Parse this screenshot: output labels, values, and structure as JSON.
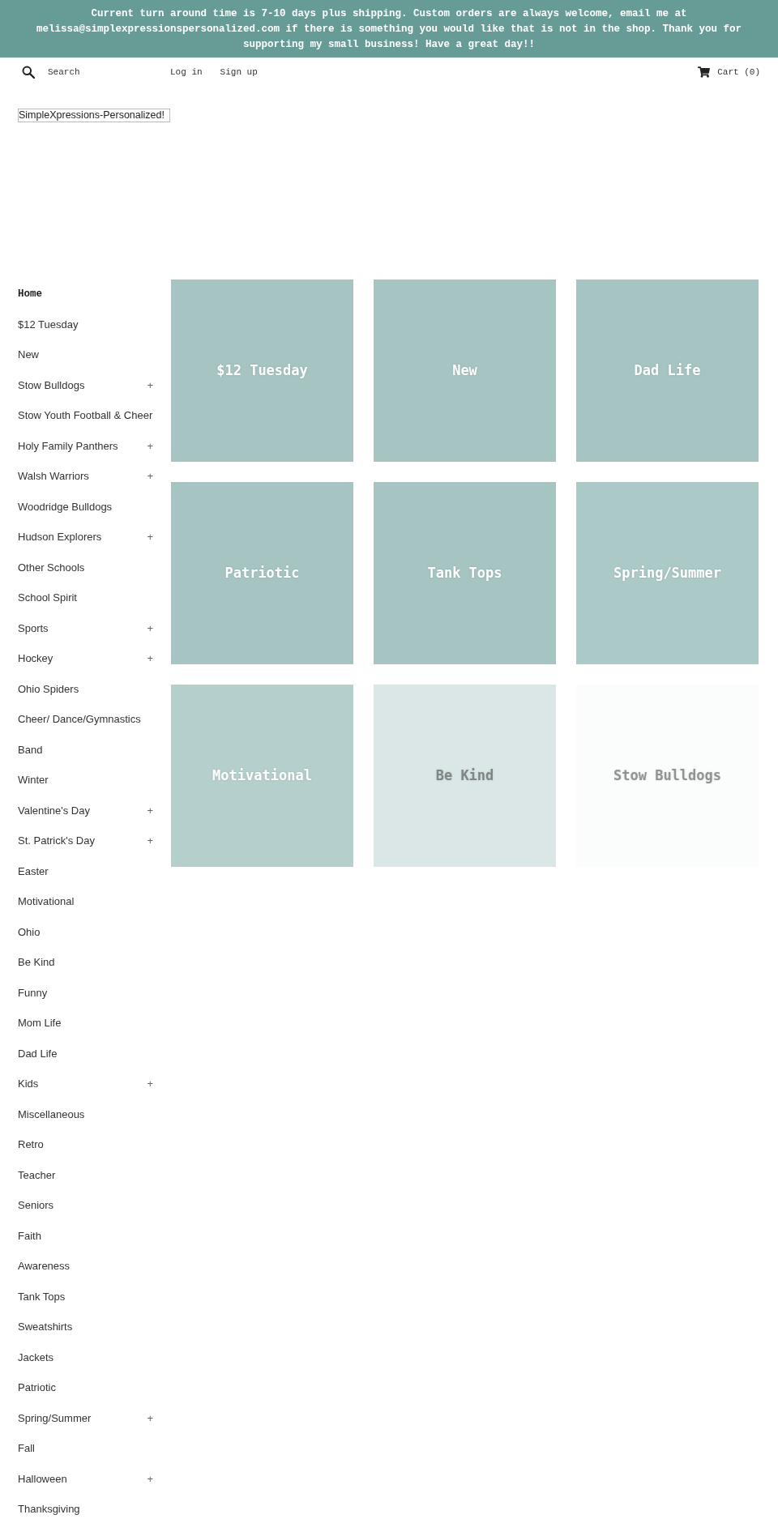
{
  "announcement": {
    "text": "Current turn around time is 7-10 days plus shipping. Custom orders are always welcome, email me at melissa@simplexpressionspersonalized.com if there is something you would like that is not in the shop. Thank you for supporting my small business! Have a great day!!"
  },
  "header": {
    "search": {
      "placeholder": "Search"
    },
    "links": [
      "Log in",
      "Sign up"
    ],
    "cart": {
      "label": "Cart (0)"
    }
  },
  "logo": {
    "alt_text": "SimpleXpressions-Personalized!"
  },
  "sidebar": {
    "items": [
      {
        "label": "Home",
        "selected": true
      },
      {
        "label": "$12 Tuesday",
        "selected": false
      },
      {
        "label": "New",
        "selected": false
      },
      {
        "label": "Stow Bulldogs",
        "selected": false,
        "toggle": "+"
      },
      {
        "label": "Stow Youth Football & Cheer",
        "selected": false
      },
      {
        "label": "Holy Family Panthers",
        "selected": false,
        "toggle": "+"
      },
      {
        "label": "Walsh Warriors",
        "selected": false,
        "toggle": "+"
      },
      {
        "label": "Woodridge Bulldogs",
        "selected": false
      },
      {
        "label": "Hudson Explorers",
        "selected": false,
        "toggle": "+"
      },
      {
        "label": "Other Schools",
        "selected": false
      },
      {
        "label": "School Spirit",
        "selected": false
      },
      {
        "label": "Sports",
        "selected": false,
        "toggle": "+"
      },
      {
        "label": "Hockey",
        "selected": false,
        "toggle": "+"
      },
      {
        "label": "Ohio Spiders",
        "selected": false
      },
      {
        "label": "Cheer/ Dance/Gymnastics",
        "selected": false
      },
      {
        "label": "Band",
        "selected": false
      },
      {
        "label": "Winter",
        "selected": false
      },
      {
        "label": "Valentine's Day",
        "selected": false,
        "toggle": "+"
      },
      {
        "label": "St. Patrick's Day",
        "selected": false,
        "toggle": "+"
      },
      {
        "label": "Easter",
        "selected": false
      },
      {
        "label": "Motivational",
        "selected": false
      },
      {
        "label": "Ohio",
        "selected": false
      },
      {
        "label": "Be Kind",
        "selected": false
      },
      {
        "label": "Funny",
        "selected": false
      },
      {
        "label": "Mom Life",
        "selected": false
      },
      {
        "label": "Dad Life",
        "selected": false
      },
      {
        "label": "Kids",
        "selected": false,
        "toggle": "+"
      },
      {
        "label": "Miscellaneous",
        "selected": false
      },
      {
        "label": "Retro",
        "selected": false
      },
      {
        "label": "Teacher",
        "selected": false
      },
      {
        "label": "Seniors",
        "selected": false
      },
      {
        "label": "Faith",
        "selected": false
      },
      {
        "label": "Awareness",
        "selected": false
      },
      {
        "label": "Tank Tops",
        "selected": false
      },
      {
        "label": "Sweatshirts",
        "selected": false
      },
      {
        "label": "Jackets",
        "selected": false
      },
      {
        "label": "Patriotic",
        "selected": false
      },
      {
        "label": "Spring/Summer",
        "selected": false,
        "toggle": "+"
      },
      {
        "label": "Fall",
        "selected": false
      },
      {
        "label": "Halloween",
        "selected": false,
        "toggle": "+"
      },
      {
        "label": "Thanksgiving",
        "selected": false
      }
    ]
  },
  "collections": [
    {
      "title": "$12 Tuesday",
      "color": "#a5c4c2"
    },
    {
      "title": "New",
      "color": "#a5c4c2"
    },
    {
      "title": "Dad Life",
      "color": "#a5c4c2"
    },
    {
      "title": "Patriotic",
      "color": "#a5c4c2"
    },
    {
      "title": "Tank Tops",
      "color": "#a5c4c2"
    },
    {
      "title": "Spring/Summer",
      "color": "#abc9c7"
    },
    {
      "title": "Motivational",
      "color": "#b5cfcd"
    },
    {
      "title": "Be Kind",
      "color": "#dbe7e6"
    },
    {
      "title": "Stow Bulldogs",
      "color": "#fbfcfc"
    }
  ]
}
